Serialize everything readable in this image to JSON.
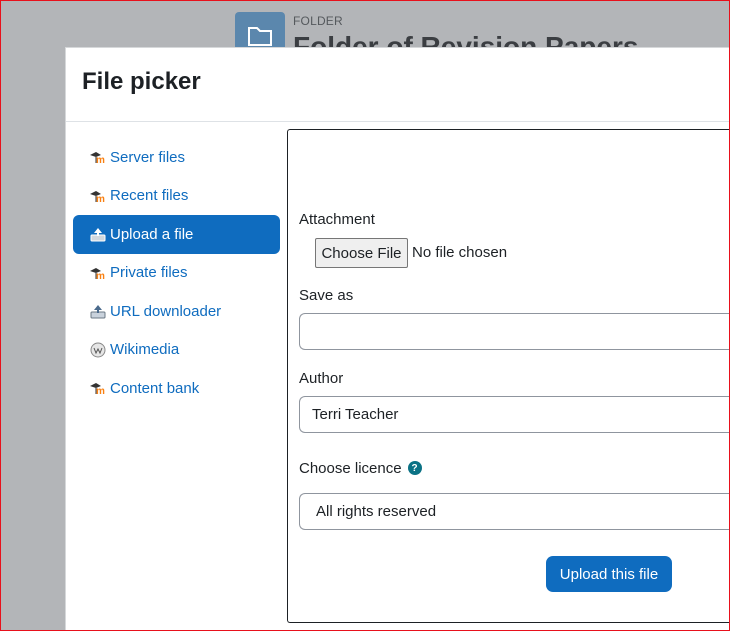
{
  "background": {
    "folder_label": "FOLDER",
    "page_title": "Folder of Revision Papers"
  },
  "dialog": {
    "title": "File picker"
  },
  "sidebar": {
    "items": [
      {
        "label": "Server files",
        "icon": "moodle-icon",
        "active": false
      },
      {
        "label": "Recent files",
        "icon": "moodle-icon",
        "active": false
      },
      {
        "label": "Upload a file",
        "icon": "upload-icon",
        "active": true
      },
      {
        "label": "Private files",
        "icon": "moodle-icon",
        "active": false
      },
      {
        "label": "URL downloader",
        "icon": "url-download-icon",
        "active": false
      },
      {
        "label": "Wikimedia",
        "icon": "wikimedia-icon",
        "active": false
      },
      {
        "label": "Content bank",
        "icon": "moodle-icon",
        "active": false
      }
    ]
  },
  "form": {
    "attachment_label": "Attachment",
    "choose_file_label": "Choose File",
    "no_file_text": "No file chosen",
    "save_as_label": "Save as",
    "save_as_value": "",
    "author_label": "Author",
    "author_value": "Terri Teacher",
    "licence_label": "Choose licence",
    "licence_help": "?",
    "licence_value": "All rights reserved",
    "upload_button_label": "Upload this file"
  },
  "colors": {
    "accent": "#0f6cbf",
    "overlay": "#b3b5b8",
    "frame_border": "#e8101b"
  }
}
